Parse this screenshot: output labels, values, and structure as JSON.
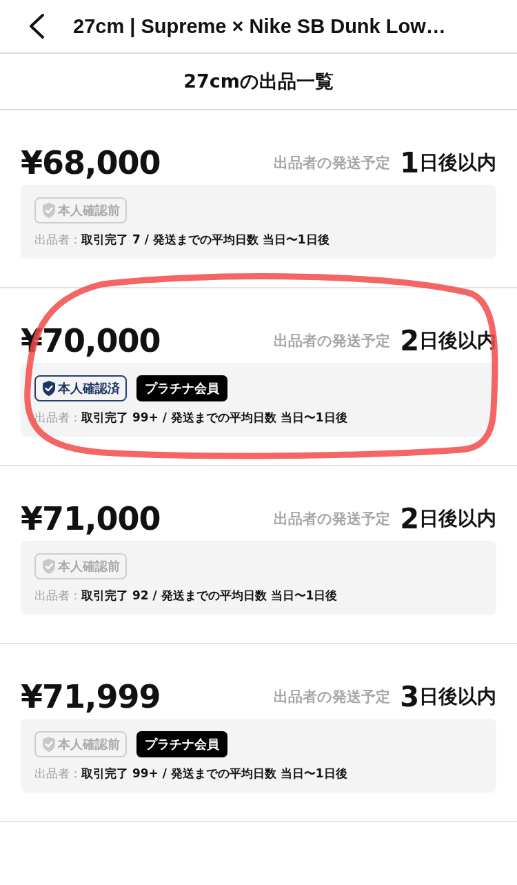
{
  "header": {
    "title": "27cm | Supreme × Nike SB Dunk Low…"
  },
  "subtitle": "27cmの出品一覧",
  "listings": [
    {
      "price": "¥68,000",
      "ship_label": "出品者の発送予定",
      "ship_number": "1",
      "ship_unit": "日後以内",
      "verification": {
        "label": "本人確認前",
        "verified": false
      },
      "seller_label": "出品者：",
      "seller_stats": "取引完了 7 / 発送までの平均日数 当日〜1日後",
      "annotated": false
    },
    {
      "price": "¥70,000",
      "ship_label": "出品者の発送予定",
      "ship_number": "2",
      "ship_unit": "日後以内",
      "verification": {
        "label": "本人確認済",
        "verified": true
      },
      "member_badge": "プラチナ会員",
      "seller_label": "出品者：",
      "seller_stats": "取引完了 99+ / 発送までの平均日数 当日〜1日後",
      "annotated": true
    },
    {
      "price": "¥71,000",
      "ship_label": "出品者の発送予定",
      "ship_number": "2",
      "ship_unit": "日後以内",
      "verification": {
        "label": "本人確認前",
        "verified": false
      },
      "seller_label": "出品者：",
      "seller_stats": "取引完了 92 / 発送までの平均日数 当日〜1日後",
      "annotated": false
    },
    {
      "price": "¥71,999",
      "ship_label": "出品者の発送予定",
      "ship_number": "3",
      "ship_unit": "日後以内",
      "verification": {
        "label": "本人確認前",
        "verified": false
      },
      "member_badge": "プラチナ会員",
      "seller_label": "出品者：",
      "seller_stats": "取引完了 99+ / 発送までの平均日数 当日〜1日後",
      "annotated": false
    }
  ]
}
